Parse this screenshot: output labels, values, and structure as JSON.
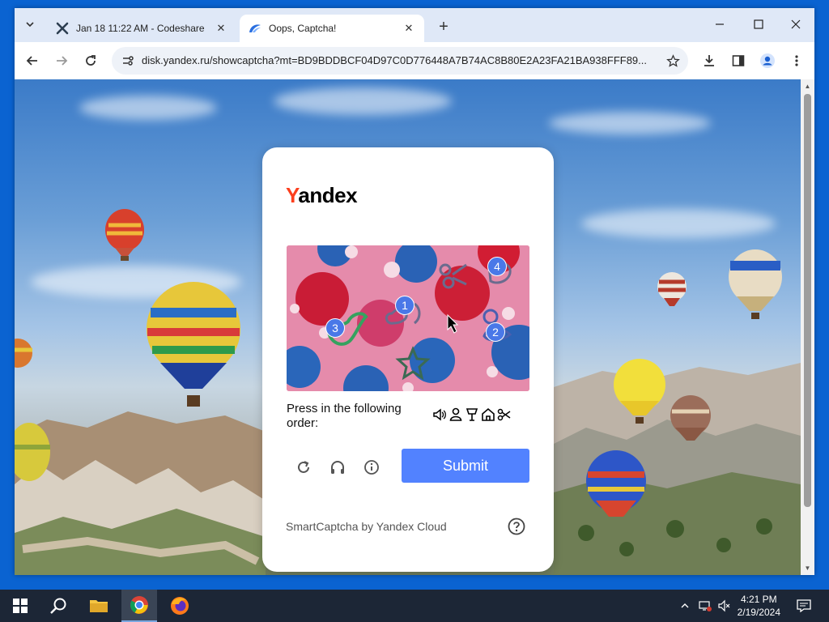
{
  "browser": {
    "tabs": [
      {
        "title": "Jan 18 11:22 AM - Codeshare",
        "active": false
      },
      {
        "title": "Oops, Captcha!",
        "active": true
      }
    ],
    "url": "disk.yandex.ru/showcaptcha?mt=BD9BDDBCF04D97C0D776448A7B74AC8B80E2A23FA21BA938FFF89..."
  },
  "captcha": {
    "logo_first": "Y",
    "logo_rest": "andex",
    "badges": [
      "1",
      "2",
      "3",
      "4"
    ],
    "instruction": "Press in the following order:",
    "order_icons": [
      "megaphone-icon",
      "person-icon",
      "lamp-icon",
      "house-icon",
      "scissors-icon"
    ],
    "submit_label": "Submit",
    "footer": "SmartCaptcha by Yandex Cloud"
  },
  "taskbar": {
    "time": "4:21 PM",
    "date": "2/19/2024"
  },
  "colors": {
    "accent": "#5282ff",
    "logo_red": "#fc3f1d",
    "badge_blue": "#4a78e8"
  }
}
